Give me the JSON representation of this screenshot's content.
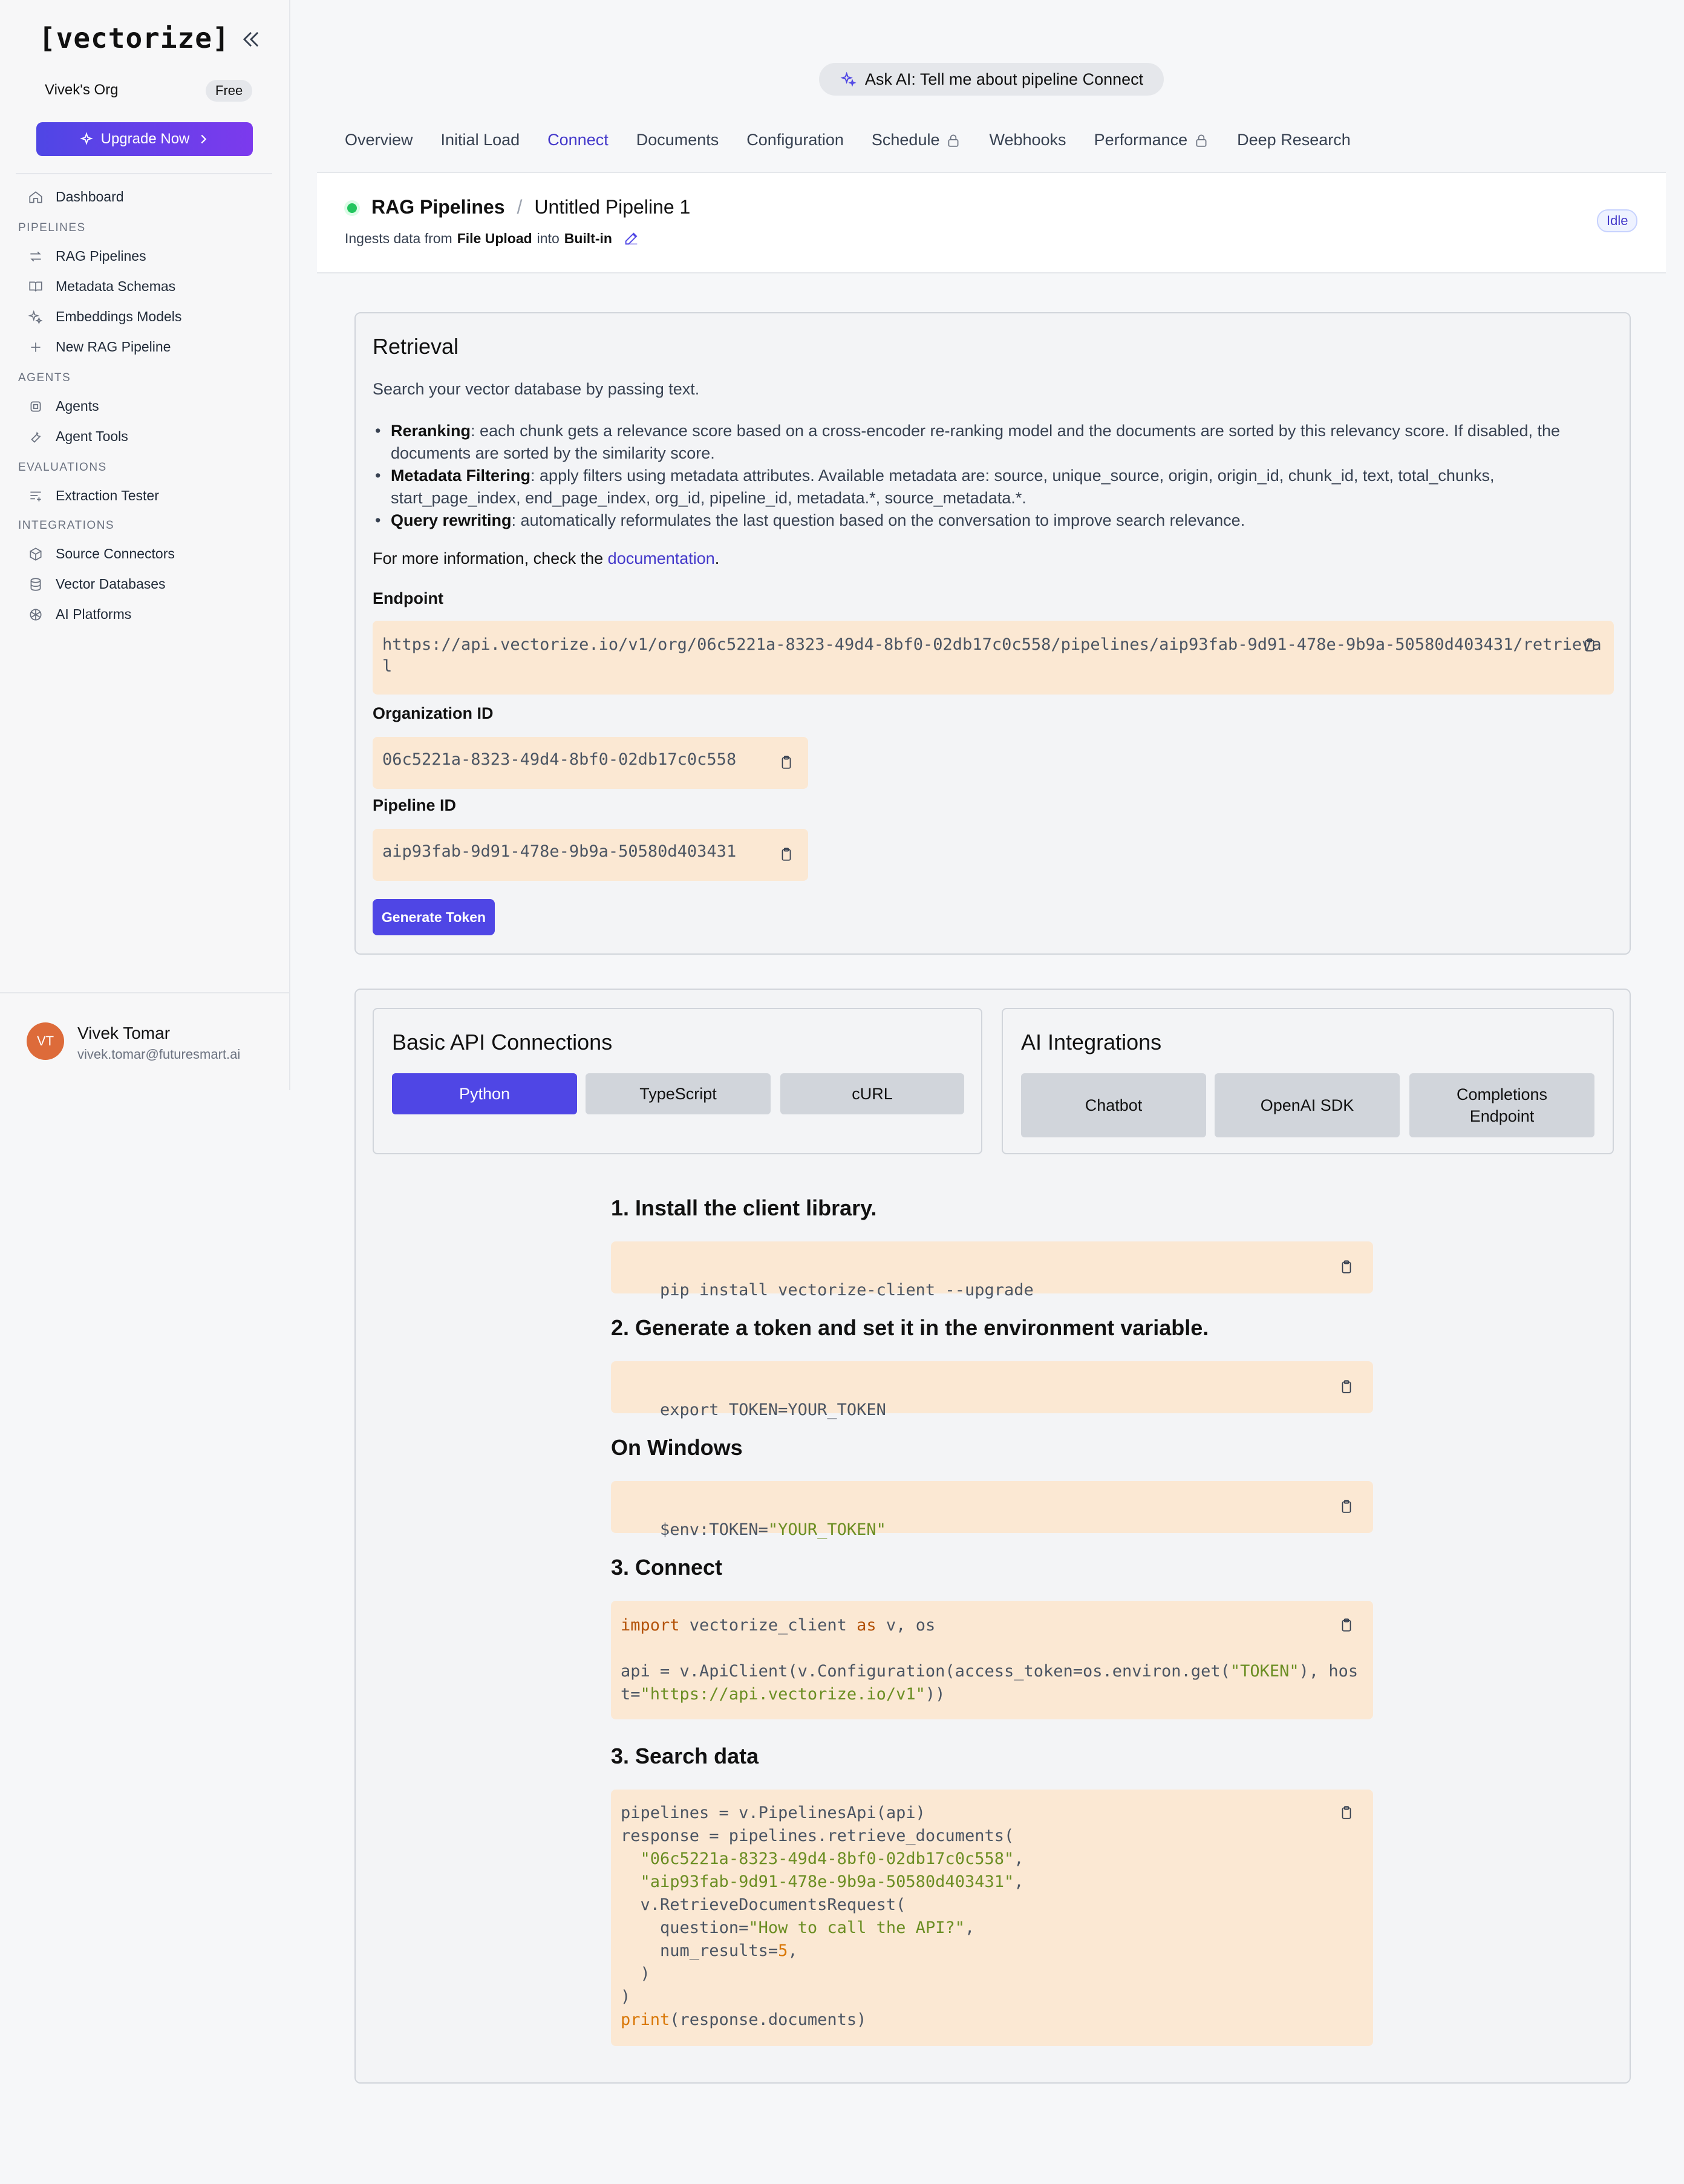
{
  "sidebar": {
    "logo": "[vectorize]",
    "org_name": "Vivek's Org",
    "plan": "Free",
    "upgrade_label": "Upgrade Now",
    "dashboard": "Dashboard",
    "sections": {
      "pipelines": "PIPELINES",
      "agents": "AGENTS",
      "evaluations": "EVALUATIONS",
      "integrations": "INTEGRATIONS"
    },
    "items": {
      "rag_pipelines": "RAG Pipelines",
      "metadata_schemas": "Metadata Schemas",
      "embeddings_models": "Embeddings Models",
      "new_rag_pipeline": "New RAG Pipeline",
      "agents": "Agents",
      "agent_tools": "Agent Tools",
      "extraction_tester": "Extraction Tester",
      "source_connectors": "Source Connectors",
      "vector_databases": "Vector Databases",
      "ai_platforms": "AI Platforms"
    },
    "user": {
      "initials": "VT",
      "name": "Vivek Tomar",
      "email": "vivek.tomar@futuresmart.ai"
    }
  },
  "header": {
    "ask_ai": "Ask AI: Tell me about pipeline Connect",
    "tabs": [
      "Overview",
      "Initial Load",
      "Connect",
      "Documents",
      "Configuration",
      "Schedule",
      "Webhooks",
      "Performance",
      "Deep Research"
    ],
    "active_tab": "Connect"
  },
  "pipeline": {
    "crumb_root": "RAG Pipelines",
    "crumb_sep": "/",
    "name": "Untitled Pipeline 1",
    "ingest_prefix": "Ingests data from",
    "source": "File Upload",
    "ingest_mid": "into",
    "destination": "Built-in",
    "status": "Idle",
    "status_color": "#22c55e"
  },
  "retrieval": {
    "title": "Retrieval",
    "description": "Search your vector database by passing text.",
    "bullets": [
      {
        "term": "Reranking",
        "text": ": each chunk gets a relevance score based on a cross-encoder re-ranking model and the documents are sorted by this relevancy score. If disabled, the documents are sorted by the similarity score."
      },
      {
        "term": "Metadata Filtering",
        "text": ": apply filters using metadata attributes. Available metadata are: source, unique_source, origin, origin_id, chunk_id, text, total_chunks, start_page_index, end_page_index, org_id, pipeline_id, metadata.*, source_metadata.*."
      },
      {
        "term": "Query rewriting",
        "text": ": automatically reformulates the last question based on the conversation to improve search relevance."
      }
    ],
    "more_prefix": "For more information, check the",
    "more_link": "documentation",
    "more_suffix": ".",
    "endpoint_label": "Endpoint",
    "endpoint": "https://api.vectorize.io/v1/org/06c5221a-8323-49d4-8bf0-02db17c0c558/pipelines/aip93fab-9d91-478e-9b9a-50580d403431/retrieval",
    "org_id_label": "Organization ID",
    "org_id": "06c5221a-8323-49d4-8bf0-02db17c0c558",
    "pipeline_id_label": "Pipeline ID",
    "pipeline_id": "aip93fab-9d91-478e-9b9a-50580d403431",
    "generate_token": "Generate Token"
  },
  "connections": {
    "basic_title": "Basic API Connections",
    "basic_options": [
      "Python",
      "TypeScript",
      "cURL"
    ],
    "basic_active": "Python",
    "ai_title": "AI Integrations",
    "ai_options": [
      "Chatbot",
      "OpenAI SDK",
      "Completions Endpoint"
    ],
    "steps": {
      "install_title": "1. Install the client library.",
      "install_code": "pip install vectorize-client --upgrade",
      "token_title": "2. Generate a token and set it in the environment variable.",
      "token_code": "export TOKEN=YOUR_TOKEN",
      "windows_title": "On Windows",
      "windows_prefix": "$env:TOKEN=",
      "windows_value": "\"YOUR_TOKEN\"",
      "connect_title": "3. Connect",
      "connect_import_kw": "import",
      "connect_import_rest": " vectorize_client ",
      "connect_as": "as",
      "connect_import_tail": " v, os",
      "connect_line2a": "api = v.ApiClient(v.Configuration(access_token=os.environ.get(",
      "connect_token_str": "\"TOKEN\"",
      "connect_line2b": "), hos",
      "connect_line3a": "t=",
      "connect_host_str": "\"https://api.vectorize.io/v1\"",
      "connect_line3b": "))",
      "search_title": "3. Search data",
      "search_l1": "pipelines = v.PipelinesApi(api)",
      "search_l2": "response = pipelines.retrieve_documents(",
      "search_l3": "\"06c5221a-8323-49d4-8bf0-02db17c0c558\"",
      "search_l4": "\"aip93fab-9d91-478e-9b9a-50580d403431\"",
      "search_l5": "v.RetrieveDocumentsRequest(",
      "search_l6a": "question=",
      "search_l6b": "\"How to call the API?\"",
      "search_l7a": "num_results=",
      "search_l7b": "5",
      "search_l8": ")",
      "search_l9": ")",
      "search_print": "print",
      "search_l10": "(response.documents)"
    }
  },
  "colors": {
    "accent": "#4f46e5",
    "code_bg": "#fbe8d3",
    "string": "#6b8e23",
    "keyword": "#d97706"
  }
}
